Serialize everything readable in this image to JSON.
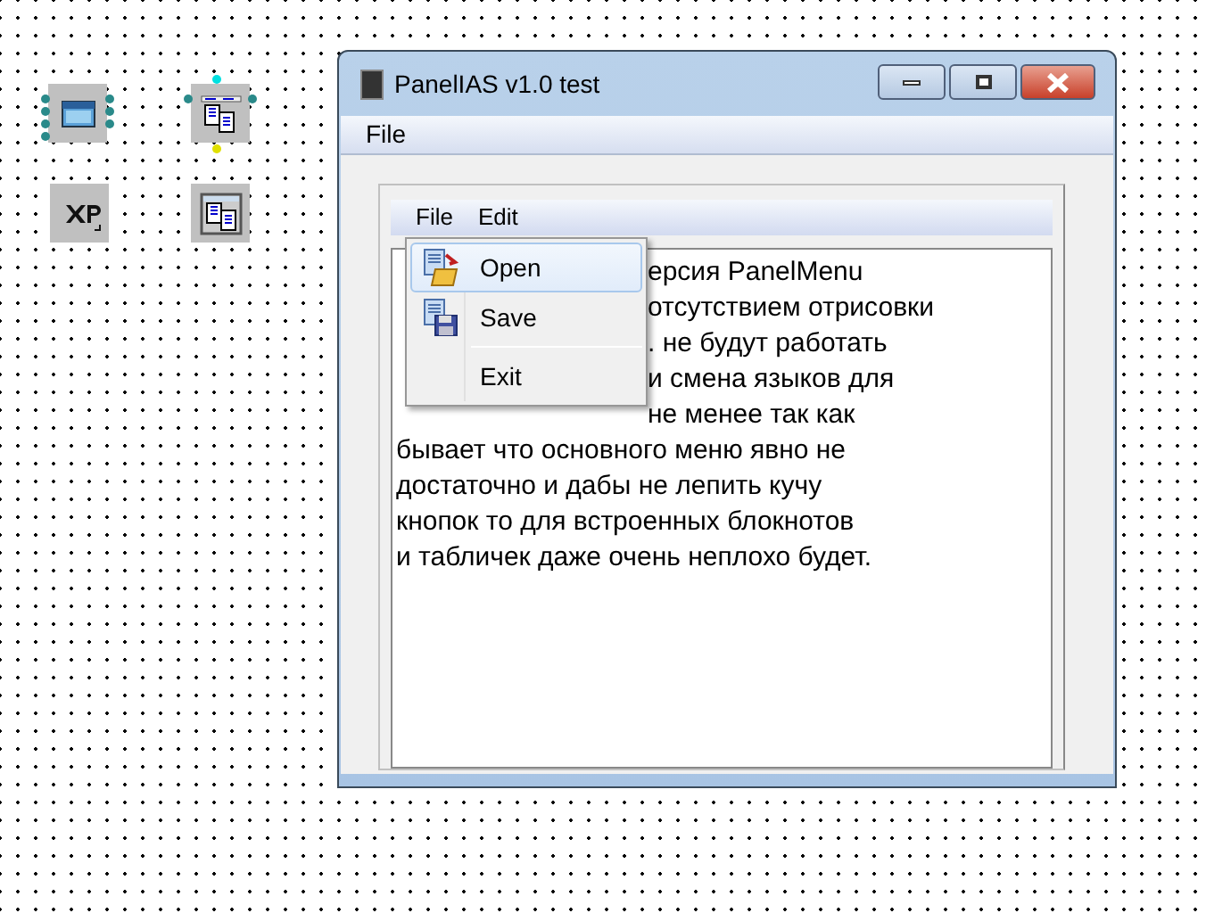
{
  "components": [
    {
      "kind": "form"
    },
    {
      "kind": "panel-menu",
      "selected": true
    },
    {
      "kind": "xp"
    },
    {
      "kind": "panel"
    }
  ],
  "window": {
    "title": "PanelIAS v1.0 test",
    "menu": [
      "File"
    ]
  },
  "panel": {
    "menu": [
      "File",
      "Edit"
    ],
    "popup": [
      {
        "kind": "item",
        "label": "Open",
        "selected": true
      },
      {
        "kind": "item",
        "label": "Save",
        "selected": false
      },
      {
        "kind": "separator"
      },
      {
        "kind": "item",
        "label": "Exit",
        "selected": false
      }
    ],
    "memo_covered": [
      "ерсия PanelMenu",
      "отсутствием отрисовки",
      ". не будут работать",
      "и смена языков для",
      "не менее так как"
    ],
    "memo_lines": [
      "бывает что основного меню явно не",
      "достаточно и дабы не лепить кучу",
      "кнопок то для встроенных блокнотов",
      "и табличек даже очень неплохо будет."
    ]
  }
}
